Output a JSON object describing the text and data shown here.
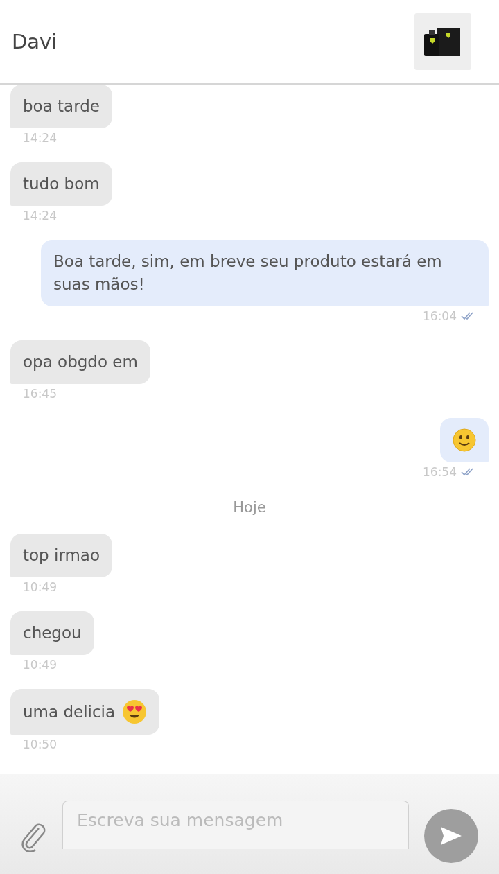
{
  "header": {
    "title": "Davi"
  },
  "messages": [
    {
      "kind": "text",
      "outgoing": false,
      "text": "boa tarde",
      "time": "14:24"
    },
    {
      "kind": "text",
      "outgoing": false,
      "text": "tudo bom",
      "time": "14:24"
    },
    {
      "kind": "text",
      "outgoing": true,
      "text": "Boa tarde, sim, em breve seu produto estará em suas mãos!",
      "time": "16:04",
      "read": true
    },
    {
      "kind": "text",
      "outgoing": false,
      "text": "opa obgdo em",
      "time": "16:45"
    },
    {
      "kind": "smile",
      "outgoing": true,
      "time": "16:54",
      "read": true
    },
    {
      "kind": "date",
      "text": "Hoje"
    },
    {
      "kind": "text",
      "outgoing": false,
      "text": "top irmao",
      "time": "10:49"
    },
    {
      "kind": "text",
      "outgoing": false,
      "text": "chegou",
      "time": "10:49"
    },
    {
      "kind": "heart-eyes",
      "outgoing": false,
      "text": "uma delicia",
      "time": "10:50"
    }
  ],
  "composer": {
    "placeholder": "Escreva sua mensagem"
  }
}
